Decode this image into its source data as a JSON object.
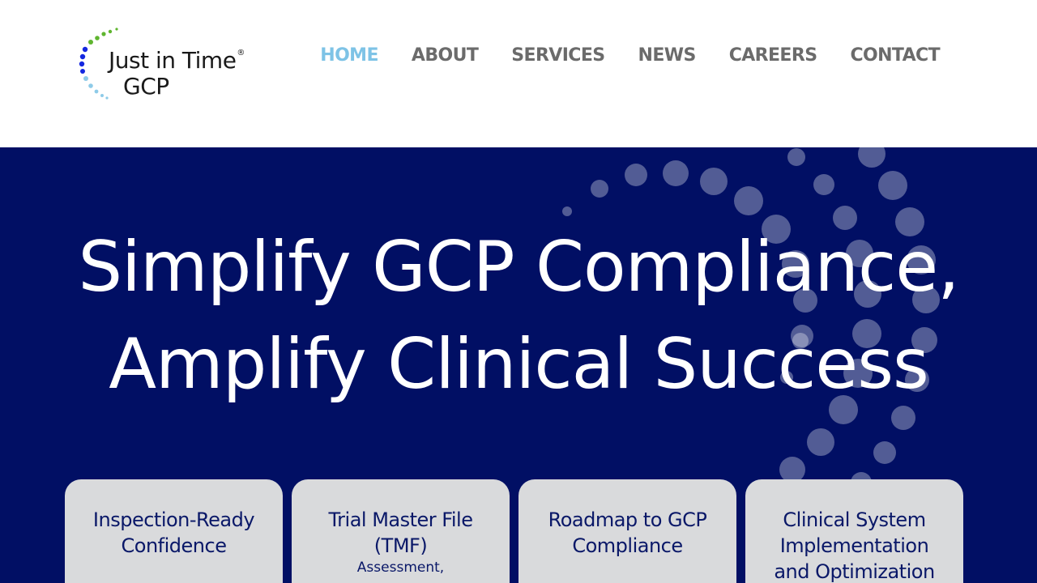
{
  "brand": {
    "line1": "Just in Time",
    "registered": "®",
    "line2": "GCP"
  },
  "nav": {
    "items": [
      {
        "label": "HOME",
        "active": true
      },
      {
        "label": "ABOUT",
        "active": false
      },
      {
        "label": "SERVICES",
        "active": false
      },
      {
        "label": "NEWS",
        "active": false
      },
      {
        "label": "CAREERS",
        "active": false
      },
      {
        "label": "CONTACT",
        "active": false
      }
    ]
  },
  "hero": {
    "title_line1": "Simplify GCP Compliance,",
    "title_line2": "Amplify Clinical Success"
  },
  "cards": [
    {
      "title": "Inspection-Ready Confidence",
      "subtitle": ""
    },
    {
      "title": "Trial Master File (TMF)",
      "subtitle": "Assessment,"
    },
    {
      "title": "Roadmap to GCP Compliance",
      "subtitle": ""
    },
    {
      "title": "Clinical System Implementation and Optimization",
      "subtitle": ""
    }
  ],
  "colors": {
    "hero_bg": "#010f64",
    "nav_active": "#7ec3e6",
    "nav_default": "#6b6b6b",
    "card_bg": "#d9dadc",
    "card_text": "#0a1868",
    "logo_green": "#5fb52f",
    "logo_blue": "#1427e0",
    "logo_light_blue": "#8ecbe8"
  }
}
